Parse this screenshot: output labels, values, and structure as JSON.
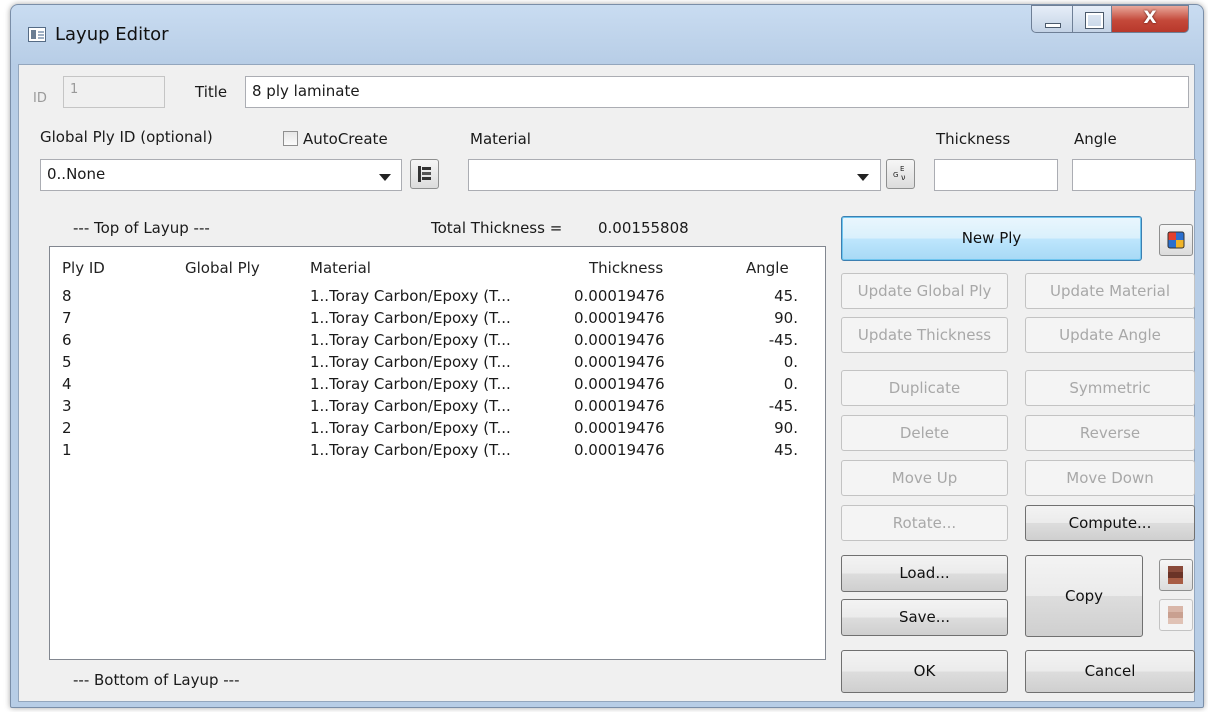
{
  "window": {
    "title": "Layup Editor"
  },
  "header": {
    "id_label": "ID",
    "id_value": "1",
    "title_label": "Title",
    "title_value": "8 ply laminate"
  },
  "ply_inputs": {
    "global_ply_label": "Global Ply ID (optional)",
    "autocreate_label": "AutoCreate",
    "autocreate_checked": false,
    "global_ply_value": "0..None",
    "material_label": "Material",
    "material_value": "",
    "thickness_label": "Thickness",
    "thickness_value": "",
    "angle_label": "Angle",
    "angle_value": ""
  },
  "layup": {
    "top_label": "--- Top of Layup ---",
    "bottom_label": "--- Bottom of Layup ---",
    "total_thickness_label": "Total Thickness =",
    "total_thickness_value": "0.00155808",
    "columns": [
      "Ply ID",
      "Global Ply",
      "Material",
      "Thickness",
      "Angle"
    ],
    "rows": [
      {
        "ply_id": "8",
        "global_ply": "",
        "material": "1..Toray Carbon/Epoxy (T...",
        "thickness": "0.00019476",
        "angle": "45."
      },
      {
        "ply_id": "7",
        "global_ply": "",
        "material": "1..Toray Carbon/Epoxy (T...",
        "thickness": "0.00019476",
        "angle": "90."
      },
      {
        "ply_id": "6",
        "global_ply": "",
        "material": "1..Toray Carbon/Epoxy (T...",
        "thickness": "0.00019476",
        "angle": "-45."
      },
      {
        "ply_id": "5",
        "global_ply": "",
        "material": "1..Toray Carbon/Epoxy (T...",
        "thickness": "0.00019476",
        "angle": "0."
      },
      {
        "ply_id": "4",
        "global_ply": "",
        "material": "1..Toray Carbon/Epoxy (T...",
        "thickness": "0.00019476",
        "angle": "0."
      },
      {
        "ply_id": "3",
        "global_ply": "",
        "material": "1..Toray Carbon/Epoxy (T...",
        "thickness": "0.00019476",
        "angle": "-45."
      },
      {
        "ply_id": "2",
        "global_ply": "",
        "material": "1..Toray Carbon/Epoxy (T...",
        "thickness": "0.00019476",
        "angle": "90."
      },
      {
        "ply_id": "1",
        "global_ply": "",
        "material": "1..Toray Carbon/Epoxy (T...",
        "thickness": "0.00019476",
        "angle": "45."
      }
    ]
  },
  "buttons": {
    "new_ply": "New Ply",
    "update_global_ply": "Update Global Ply",
    "update_material": "Update Material",
    "update_thickness": "Update Thickness",
    "update_angle": "Update Angle",
    "duplicate": "Duplicate",
    "symmetric": "Symmetric",
    "delete": "Delete",
    "reverse": "Reverse",
    "move_up": "Move Up",
    "move_down": "Move Down",
    "rotate": "Rotate...",
    "compute": "Compute...",
    "load": "Load...",
    "save": "Save...",
    "copy": "Copy",
    "ok": "OK",
    "cancel": "Cancel"
  },
  "icons": {
    "app": "layup-editor-app-icon",
    "global_ply_select": "ply-select-icon",
    "material_select": "material-select-icon",
    "color_palette": "color-palette-icon",
    "copy_ply": "copy-stack-icon",
    "paste_ply": "paste-stack-icon"
  },
  "colors": {
    "window_frame": "#b7cde6",
    "dialog_bg": "#f0f0f0",
    "primary_button": "#bee6fd",
    "close_button": "#c4493a"
  }
}
